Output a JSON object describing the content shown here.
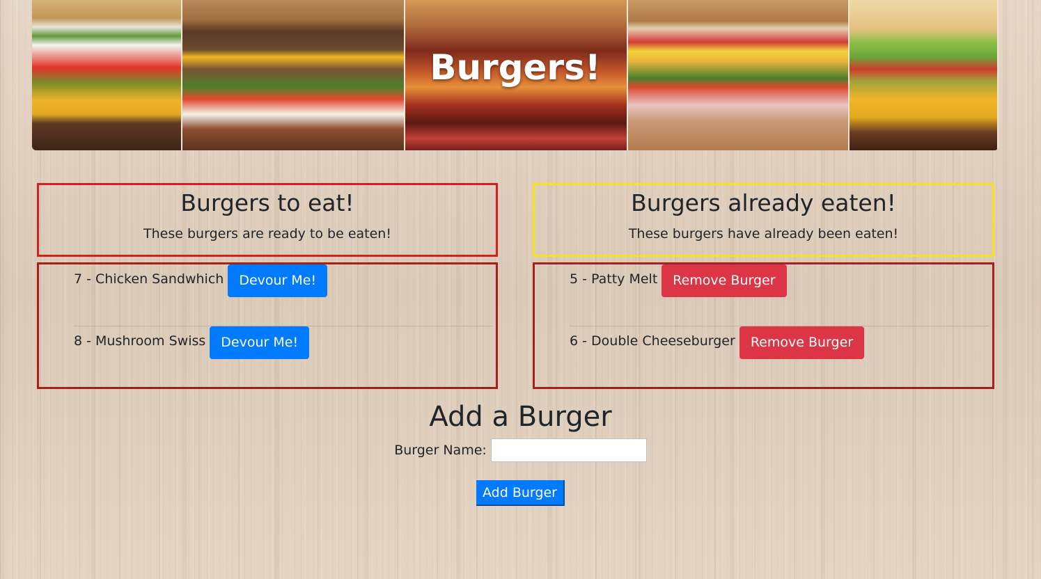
{
  "banner": {
    "title": "Burgers!"
  },
  "to_eat": {
    "heading": "Burgers to eat!",
    "subtitle": "These burgers are ready to be eaten!",
    "items": [
      {
        "label": "7 - Chicken Sandwhich",
        "button": "Devour Me!"
      },
      {
        "label": "8 - Mushroom Swiss",
        "button": "Devour Me!"
      }
    ]
  },
  "eaten": {
    "heading": "Burgers already eaten!",
    "subtitle": "These burgers have already been eaten!",
    "items": [
      {
        "label": "5 - Patty Melt",
        "button": "Remove Burger"
      },
      {
        "label": "6 - Double Cheeseburger",
        "button": "Remove Burger"
      }
    ]
  },
  "add_form": {
    "title": "Add a Burger",
    "name_label": "Burger Name:",
    "name_value": "",
    "submit_label": "Add Burger"
  },
  "colors": {
    "to_eat_border": "#d81f1f",
    "eaten_border": "#f2e51b",
    "list_border": "#a8201a",
    "primary_button": "#007bff",
    "danger_button": "#dc3545"
  }
}
